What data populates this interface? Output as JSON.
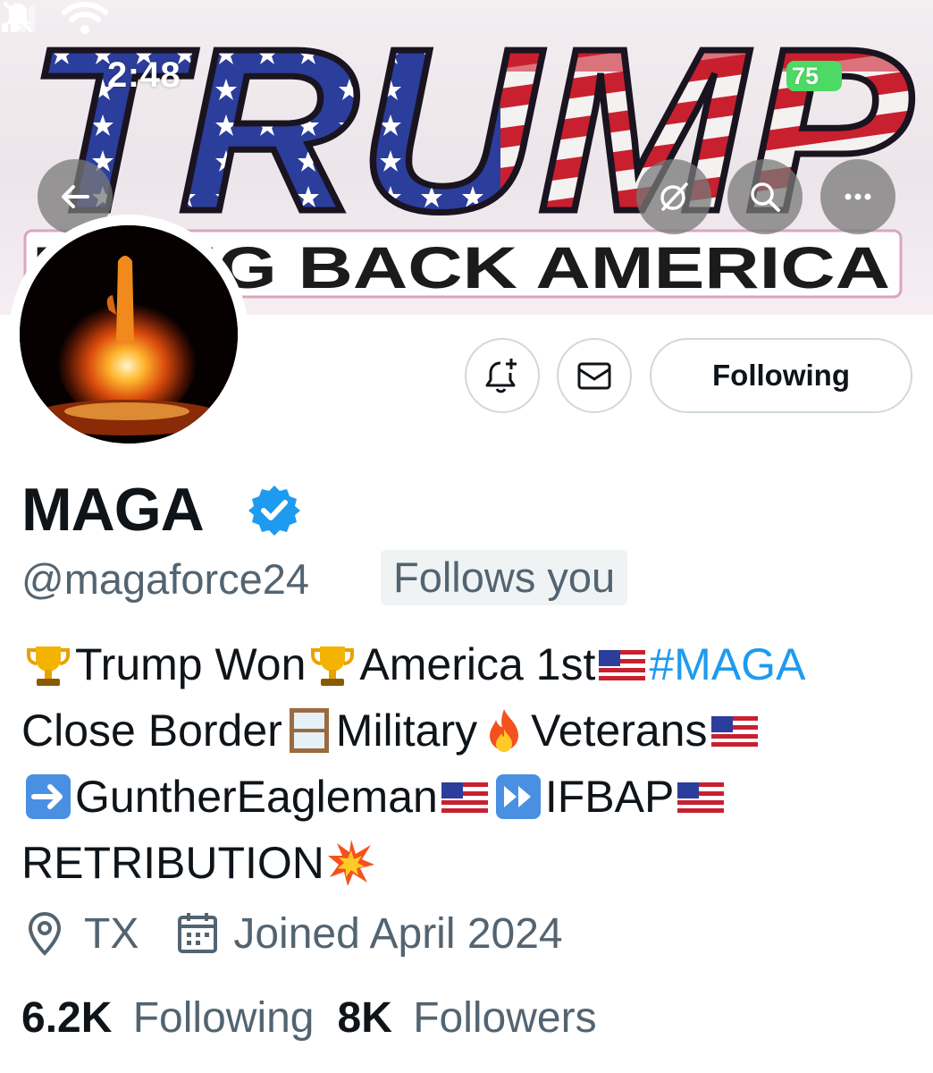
{
  "status_bar": {
    "time": "2:48",
    "battery": "75"
  },
  "banner": {
    "logo_text": "TRUMP",
    "tagline": "BRING BACK AMERICA"
  },
  "header_buttons": {
    "back": "back-arrow-icon",
    "grok": "grok-icon",
    "search": "search-icon",
    "more": "more-icon"
  },
  "actions": {
    "notify": "bell-plus-icon",
    "message": "envelope-icon",
    "following_label": "Following"
  },
  "profile": {
    "display_name": "MAGA",
    "verified": true,
    "handle": "@magaforce24",
    "follows_you": "Follows you",
    "bio": {
      "line1": {
        "t1": "Trump Won",
        "t2": "America 1st",
        "hashtag": "#MAGA"
      },
      "line2": {
        "t1": "Close Border",
        "t2": "Military",
        "t3": "Veterans"
      },
      "line3": {
        "t1": "GuntherEagleman",
        "t2": "IFBAP "
      },
      "line4": {
        "t1": "RETRIBUTION"
      }
    },
    "location": "TX",
    "joined": "Joined April 2024",
    "following_count": "6.2K",
    "following_label": "Following",
    "followers_count": "8K",
    "followers_label": "Followers"
  },
  "colors": {
    "link": "#1d9bf0",
    "secondary_text": "#536471",
    "verified": "#1d9bf0",
    "battery": "#4cd964"
  }
}
